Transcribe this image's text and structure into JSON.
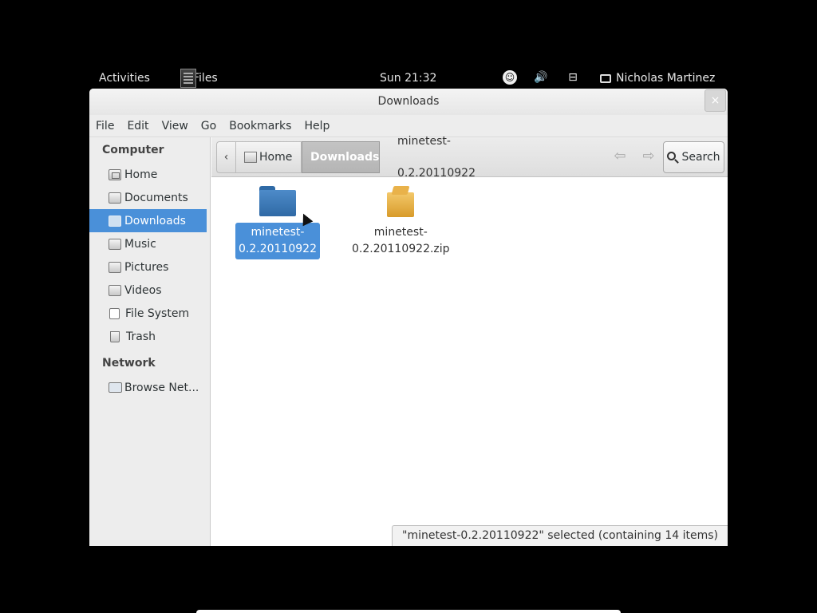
{
  "topbar": {
    "activities": "Activities",
    "app_name": "Files",
    "clock": "Sun 21:32",
    "user": "Nicholas Martinez",
    "icons": [
      "accessibility-icon",
      "volume-icon",
      "network-icon",
      "chat-icon"
    ]
  },
  "window": {
    "title": "Downloads",
    "close_glyph": "×"
  },
  "menubar": {
    "items": [
      "File",
      "Edit",
      "View",
      "Go",
      "Bookmarks",
      "Help"
    ]
  },
  "sidebar": {
    "computer_heading": "Computer",
    "computer_items": [
      {
        "label": "Home",
        "icon": "home-folder-icon"
      },
      {
        "label": "Documents",
        "icon": "folder-icon"
      },
      {
        "label": "Downloads",
        "icon": "folder-icon",
        "active": true
      },
      {
        "label": "Music",
        "icon": "folder-icon"
      },
      {
        "label": "Pictures",
        "icon": "folder-icon"
      },
      {
        "label": "Videos",
        "icon": "folder-icon"
      },
      {
        "label": "File System",
        "icon": "drive-icon"
      },
      {
        "label": "Trash",
        "icon": "trash-icon"
      }
    ],
    "network_heading": "Network",
    "network_items": [
      {
        "label": "Browse Net...",
        "icon": "network-icon"
      }
    ]
  },
  "toolbar": {
    "back_glyph": "‹",
    "crumb_home": "Home",
    "crumb_current": "Downloads",
    "crumb_child": "minetest-0.2.20110922",
    "nav_back_glyph": "⇦",
    "nav_fwd_glyph": "⇨",
    "search_label": "Search"
  },
  "files": [
    {
      "line1": "minetest-",
      "line2": "0.2.20110922",
      "type": "folder",
      "selected": true
    },
    {
      "line1": "minetest-",
      "line2": "0.2.20110922.zip",
      "type": "archive",
      "selected": false
    }
  ],
  "status": "\"minetest-0.2.20110922\" selected (containing 14 items)",
  "colors": {
    "accent": "#4a90d9",
    "folder": "#3a78b8",
    "archive": "#e6a93e"
  }
}
